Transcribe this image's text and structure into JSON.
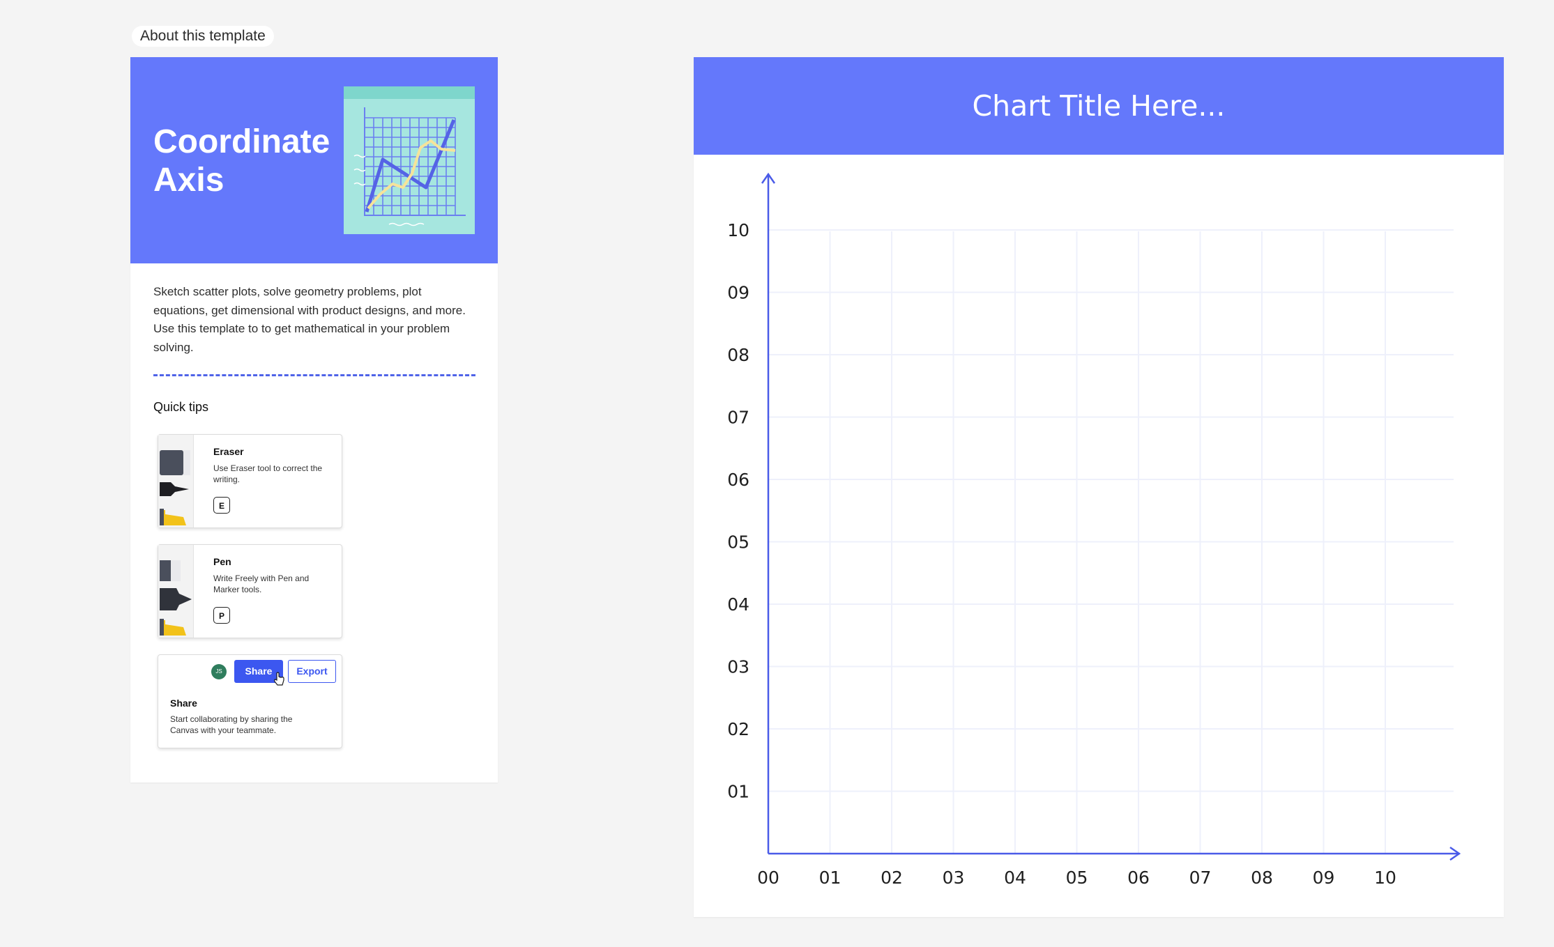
{
  "about_label": "About this template",
  "template": {
    "title_line1": "Coordinate",
    "title_line2": "Axis",
    "description": "Sketch scatter plots, solve geometry problems, plot equations, get dimensional with product designs, and more. Use this template to to get mathematical in your problem solving.",
    "quick_tips_heading": "Quick tips",
    "tips": [
      {
        "title": "Eraser",
        "text": "Use Eraser tool to correct the writing.",
        "key": "E"
      },
      {
        "title": "Pen",
        "text": "Write Freely with Pen and Marker tools.",
        "key": "P"
      }
    ],
    "share_tip": {
      "avatar_initials": "JS",
      "share_label": "Share",
      "export_label": "Export",
      "title": "Share",
      "text": "Start collaborating by sharing the Canvas with your teammate."
    }
  },
  "colors": {
    "brand": "#6478fb",
    "accent": "#3c57f0",
    "axis": "#4a5be8",
    "grid": "#eef0fb",
    "illustration_bg": "#a6e6df"
  },
  "chart_data": {
    "type": "scatter",
    "title": "Chart Title Here...",
    "x_ticks": [
      "00",
      "01",
      "02",
      "03",
      "04",
      "05",
      "06",
      "07",
      "08",
      "09",
      "10"
    ],
    "y_ticks": [
      "01",
      "02",
      "03",
      "04",
      "05",
      "06",
      "07",
      "08",
      "09",
      "10"
    ],
    "xlim": [
      0,
      10
    ],
    "ylim": [
      0,
      10
    ],
    "grid": true,
    "points": []
  }
}
